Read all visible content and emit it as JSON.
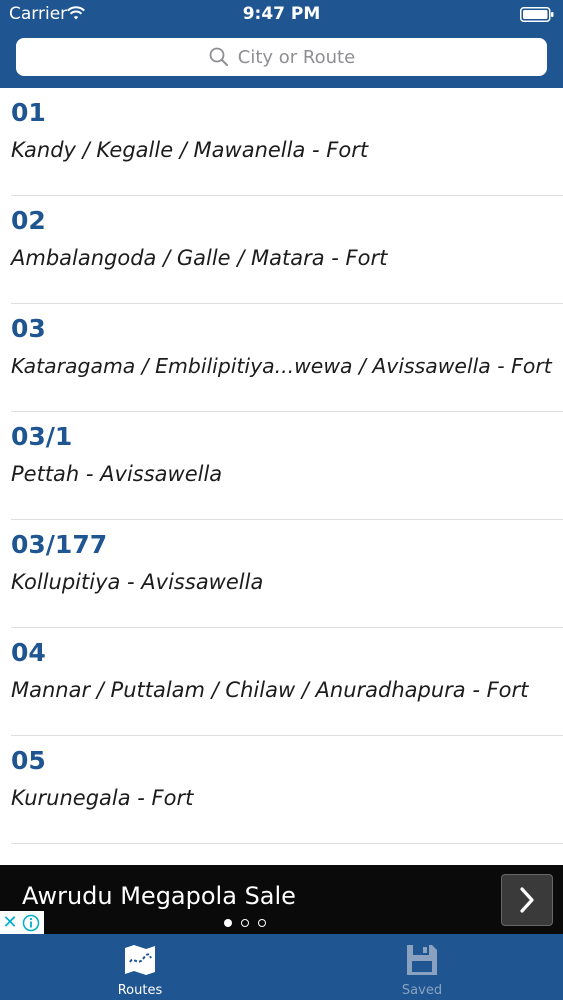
{
  "status_bar": {
    "carrier": "Carrier",
    "time": "9:47 PM"
  },
  "search": {
    "placeholder": "City or Route"
  },
  "routes": [
    {
      "number": "01",
      "description": "Kandy / Kegalle / Mawanella - Fort"
    },
    {
      "number": "02",
      "description": "Ambalangoda / Galle / Matara - Fort"
    },
    {
      "number": "03",
      "description": "Kataragama / Embilipitiya...wewa / Avissawella - Fort"
    },
    {
      "number": "03/1",
      "description": "Pettah - Avissawella"
    },
    {
      "number": "03/177",
      "description": "Kollupitiya - Avissawella"
    },
    {
      "number": "04",
      "description": "Mannar / Puttalam / Chilaw / Anuradhapura - Fort"
    },
    {
      "number": "05",
      "description": "Kurunegala - Fort"
    }
  ],
  "ad": {
    "title": "Awrudu Megapola Sale"
  },
  "tabs": [
    {
      "label": "Routes",
      "icon": "map-icon",
      "selected": true
    },
    {
      "label": "Saved",
      "icon": "floppy-disk-icon",
      "selected": false
    }
  ],
  "colors": {
    "brand_blue": "#1f5591",
    "route_number": "#1f5591",
    "tab_inactive": "#8aa2c0"
  }
}
